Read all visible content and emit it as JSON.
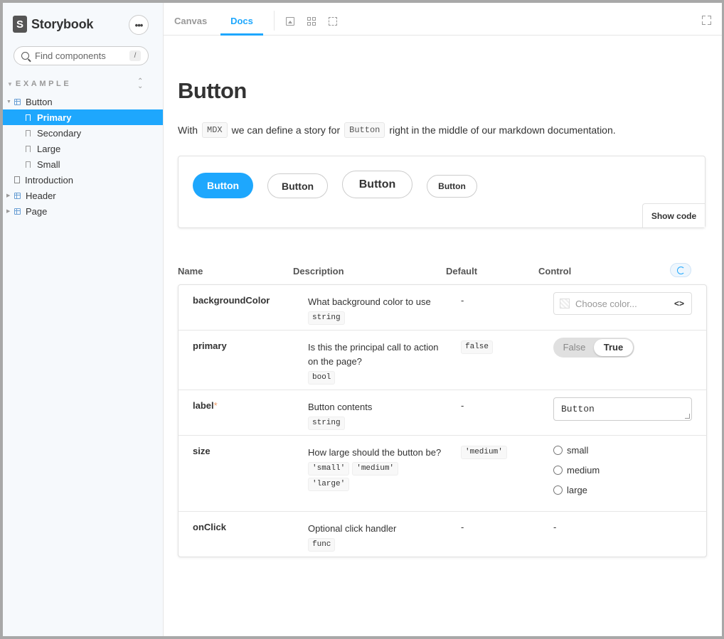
{
  "sidebar": {
    "brand": "Storybook",
    "brand_logo": "S",
    "menu_glyph": "•••",
    "search_placeholder": "Find components",
    "search_shortcut": "/",
    "group": "EXAMPLE",
    "tree": [
      {
        "label": "Button",
        "level": 1,
        "type": "component",
        "expanded": true
      },
      {
        "label": "Primary",
        "level": 2,
        "type": "story",
        "selected": true
      },
      {
        "label": "Secondary",
        "level": 2,
        "type": "story"
      },
      {
        "label": "Large",
        "level": 2,
        "type": "story"
      },
      {
        "label": "Small",
        "level": 2,
        "type": "story"
      },
      {
        "label": "Introduction",
        "level": 1,
        "type": "doc"
      },
      {
        "label": "Header",
        "level": 1,
        "type": "component"
      },
      {
        "label": "Page",
        "level": 1,
        "type": "component"
      }
    ]
  },
  "toolbar": {
    "tabs": [
      {
        "label": "Canvas"
      },
      {
        "label": "Docs",
        "active": true
      }
    ],
    "icons": [
      "image-icon",
      "grid-icon",
      "outline-icon",
      "fullscreen-icon"
    ]
  },
  "doc": {
    "title": "Button",
    "intro": {
      "part1": "With",
      "code1": "MDX",
      "part2": "we can define a story for",
      "code2": "Button",
      "part3": "right in the middle of our markdown documentation."
    },
    "preview_buttons": [
      "Button",
      "Button",
      "Button",
      "Button"
    ],
    "show_code": "Show code"
  },
  "args": {
    "headers": {
      "name": "Name",
      "description": "Description",
      "default": "Default",
      "control": "Control"
    },
    "rows": [
      {
        "name": "backgroundColor",
        "required": false,
        "description": "What background color to use",
        "types": [
          "string"
        ],
        "default": "-",
        "control": {
          "kind": "color",
          "placeholder": "Choose color...",
          "toggle": "<>"
        }
      },
      {
        "name": "primary",
        "required": false,
        "description": "Is this the principal call to action on the page?",
        "types": [
          "bool"
        ],
        "default": "false",
        "control": {
          "kind": "boolean",
          "off": "False",
          "on": "True",
          "value": true
        }
      },
      {
        "name": "label",
        "required": true,
        "required_mark": "*",
        "description": "Button contents",
        "types": [
          "string"
        ],
        "default": "-",
        "control": {
          "kind": "text",
          "value": "Button"
        }
      },
      {
        "name": "size",
        "required": false,
        "description": "How large should the button be?",
        "types": [
          "'small'",
          "'medium'",
          "'large'"
        ],
        "default": "'medium'",
        "control": {
          "kind": "radio",
          "options": [
            "small",
            "medium",
            "large"
          ]
        }
      },
      {
        "name": "onClick",
        "required": false,
        "description": "Optional click handler",
        "types": [
          "func"
        ],
        "default": "-",
        "control": {
          "kind": "none",
          "value": "-"
        }
      }
    ]
  },
  "colors": {
    "accent": "#1ea7fd",
    "text": "#333333",
    "sidebar_bg": "#f6f9fc"
  }
}
